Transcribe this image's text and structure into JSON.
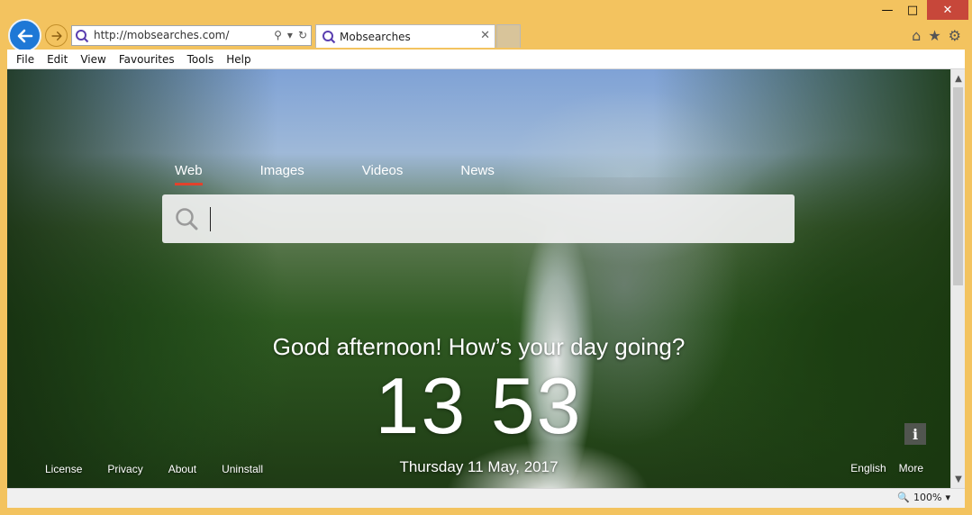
{
  "browser": {
    "address_url": "http://mobsearches.com/",
    "tab_title": "Mobsearches",
    "menu": [
      "File",
      "Edit",
      "View",
      "Favourites",
      "Tools",
      "Help"
    ],
    "zoom_level": "100%"
  },
  "page": {
    "search_tabs": [
      {
        "label": "Web",
        "active": true
      },
      {
        "label": "Images",
        "active": false
      },
      {
        "label": "Videos",
        "active": false
      },
      {
        "label": "News",
        "active": false
      }
    ],
    "search_value": "",
    "greeting": "Good afternoon! How’s your day going?",
    "clock": "13 53",
    "date": "Thursday 11 May, 2017",
    "footer_links": [
      "License",
      "Privacy",
      "About",
      "Uninstall"
    ],
    "language": "English",
    "more": "More",
    "info_label": "i"
  },
  "colors": {
    "frame": "#f3c35f",
    "back_button": "#1e78d6",
    "active_tab_underline": "#e2422c",
    "close_button": "#c7473a"
  }
}
